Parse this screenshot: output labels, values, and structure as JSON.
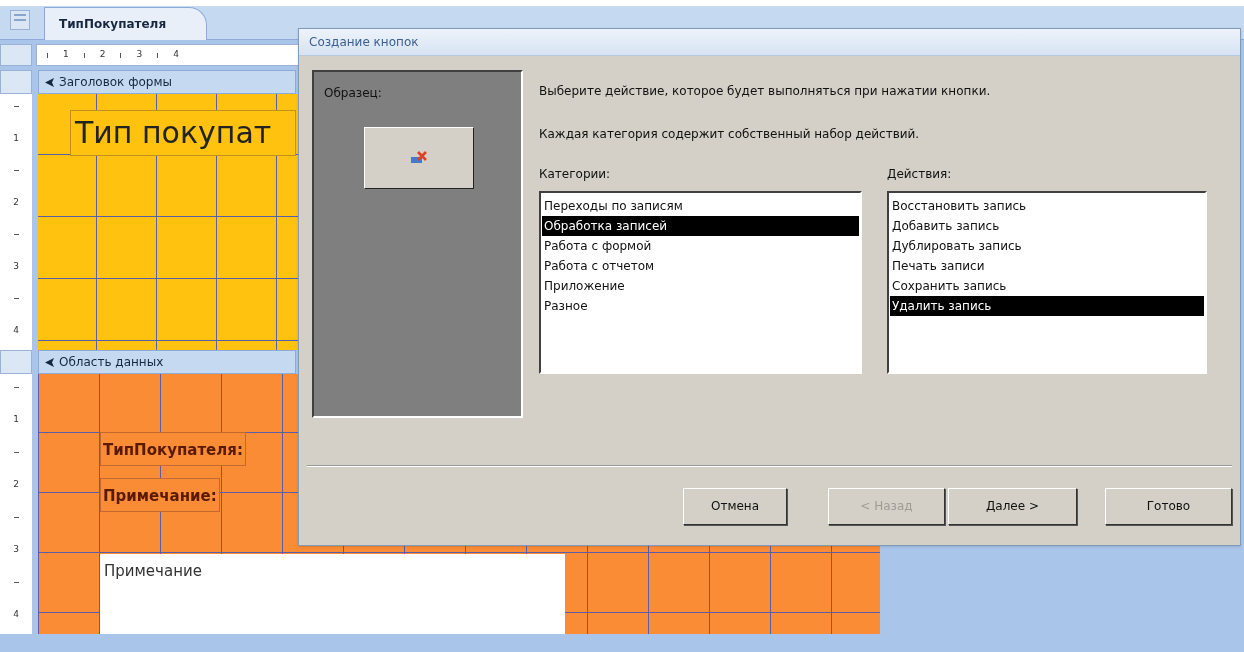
{
  "document_tab": {
    "label": "ТипПокупателя",
    "selected": true
  },
  "horizontal_ruler": {
    "numbers": [
      "1",
      "2",
      "3",
      "4"
    ]
  },
  "form_header": {
    "title": "Заголовок формы",
    "ruler_numbers": [
      "1",
      "2",
      "3",
      "4"
    ],
    "title_label": "Тип покупат"
  },
  "detail": {
    "title": "Область данных",
    "ruler_numbers": [
      "1",
      "2",
      "3",
      "4"
    ],
    "controls": [
      {
        "kind": "label",
        "text": "ТипПокупателя:"
      },
      {
        "kind": "label",
        "text": "Примечание:"
      },
      {
        "kind": "textbox",
        "text": "Примечание"
      }
    ]
  },
  "dialog": {
    "title": "Создание кнопок",
    "sample_label": "Образец:",
    "instruction": "Выберите действие, которое будет выполняться при нажатии кнопки.",
    "note": "Каждая категория содержит собственный набор действий.",
    "categories": {
      "label": "Категории:",
      "items": [
        {
          "text": "Переходы по записям",
          "selected": false
        },
        {
          "text": "Обработка записей",
          "selected": true
        },
        {
          "text": "Работа с формой",
          "selected": false
        },
        {
          "text": "Работа с отчетом",
          "selected": false
        },
        {
          "text": "Приложение",
          "selected": false
        },
        {
          "text": "Разное",
          "selected": false
        }
      ]
    },
    "actions": {
      "label": "Действия:",
      "items": [
        {
          "text": "Восстановить запись",
          "selected": false
        },
        {
          "text": "Добавить запись",
          "selected": false
        },
        {
          "text": "Дублировать запись",
          "selected": false
        },
        {
          "text": "Печать записи",
          "selected": false
        },
        {
          "text": "Сохранить запись",
          "selected": false
        },
        {
          "text": "Удалить запись",
          "selected": true
        }
      ]
    },
    "buttons": [
      {
        "label": "Отмена",
        "disabled": false
      },
      {
        "label": "< Назад",
        "disabled": true
      },
      {
        "label": "Далее >",
        "disabled": false
      },
      {
        "label": "Готово",
        "disabled": false
      }
    ]
  }
}
